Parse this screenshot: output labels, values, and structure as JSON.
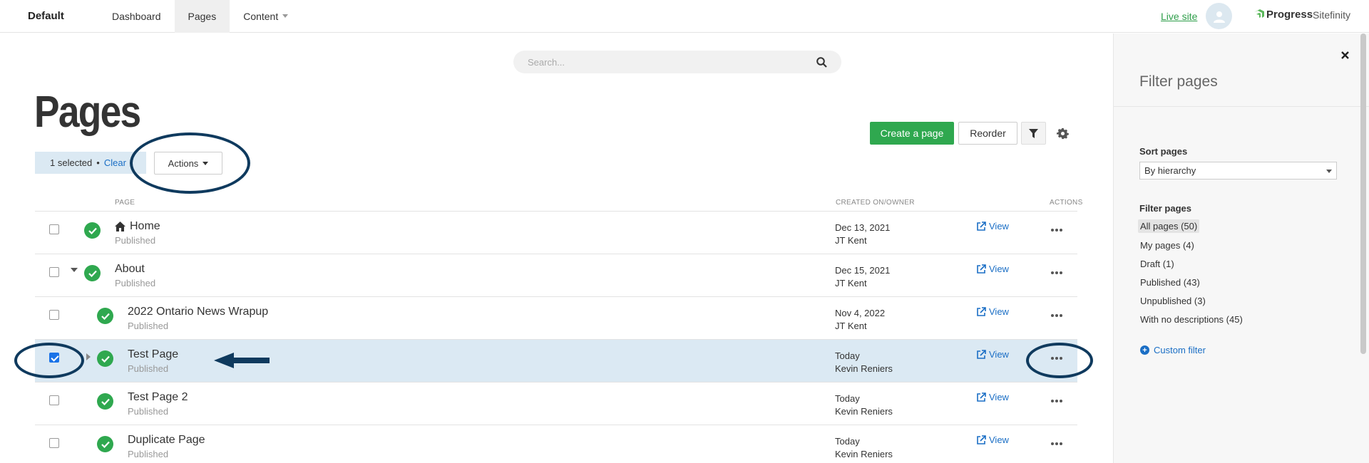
{
  "nav": {
    "site_name": "Default",
    "items": [
      {
        "label": "Dashboard"
      },
      {
        "label": "Pages"
      },
      {
        "label": "Content"
      }
    ],
    "live_site": "Live site",
    "logo_brand": "Progress",
    "logo_product": "Sitefinity"
  },
  "search": {
    "placeholder": "Search..."
  },
  "page_title": "Pages",
  "selection": {
    "count_text": "1 selected",
    "separator": "•",
    "clear": "Clear"
  },
  "actions_label": "Actions",
  "toolbar": {
    "create_label": "Create a page",
    "reorder_label": "Reorder"
  },
  "table": {
    "headers": {
      "page": "PAGE",
      "created": "CREATED ON/OWNER",
      "actions": "ACTIONS"
    },
    "view_label": "View",
    "rows": [
      {
        "title": "Home",
        "status": "Published",
        "date": "Dec 13, 2021",
        "owner": "JT Kent",
        "checked": false,
        "home": true
      },
      {
        "title": "About",
        "status": "Published",
        "date": "Dec 15, 2021",
        "owner": "JT Kent",
        "checked": false,
        "expander": "down"
      },
      {
        "title": "2022 Ontario News Wrapup",
        "status": "Published",
        "date": "Nov 4, 2022",
        "owner": "JT Kent",
        "checked": false
      },
      {
        "title": "Test Page",
        "status": "Published",
        "date": "Today",
        "owner": "Kevin Reniers",
        "checked": true,
        "expander": "right"
      },
      {
        "title": "Test Page 2",
        "status": "Published",
        "date": "Today",
        "owner": "Kevin Reniers",
        "checked": false
      },
      {
        "title": "Duplicate Page",
        "status": "Published",
        "date": "Today",
        "owner": "Kevin Reniers",
        "checked": false
      }
    ]
  },
  "panel": {
    "title": "Filter pages",
    "sort_label": "Sort pages",
    "sort_value": "By hierarchy",
    "filter_label": "Filter pages",
    "filters": [
      "All pages (50)",
      "My pages (4)",
      "Draft (1)",
      "Published (43)",
      "Unpublished (3)",
      "With no descriptions (45)"
    ],
    "custom_filter": "Custom filter"
  },
  "colors": {
    "primary": "#2fa84f",
    "link": "#1a6ec5",
    "selected_row": "#dbe9f3",
    "annotation": "#0f3a5e"
  }
}
